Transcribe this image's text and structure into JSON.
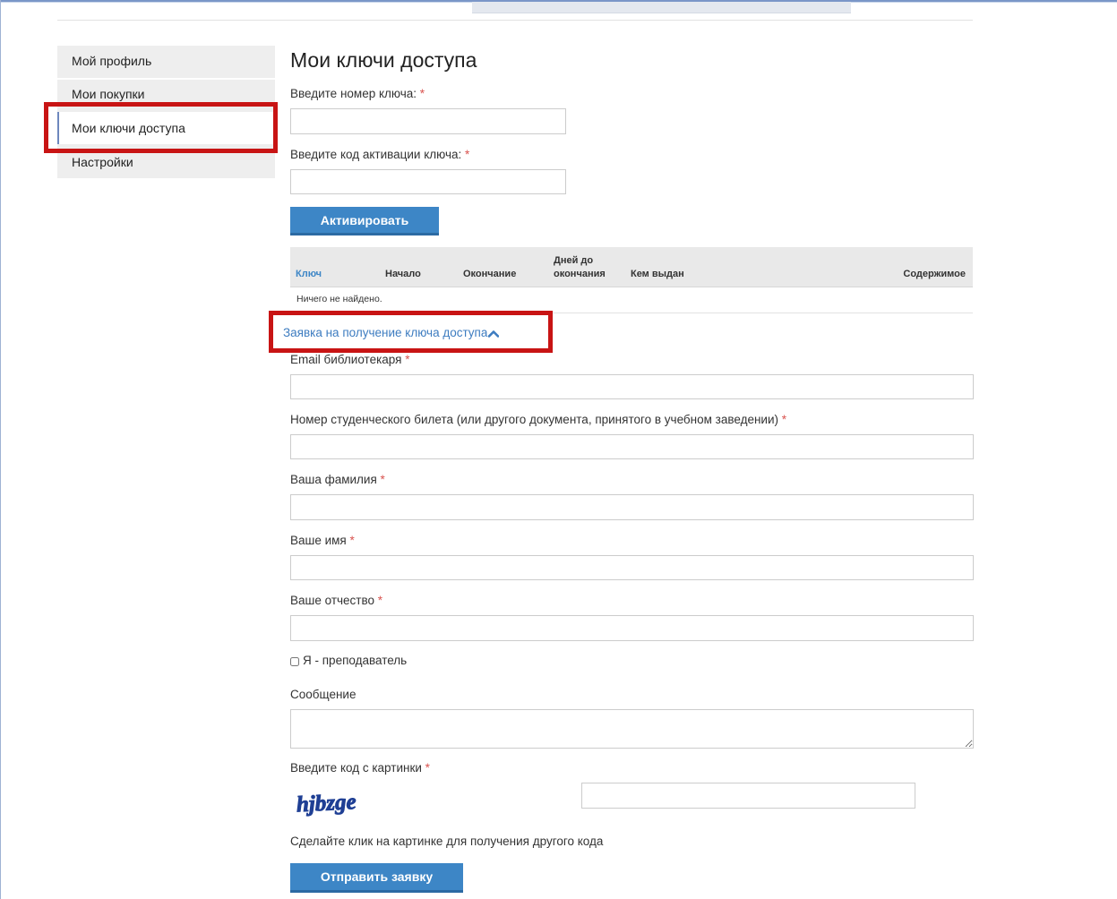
{
  "sidebar": {
    "items": [
      {
        "label": "Мой профиль"
      },
      {
        "label": "Мои покупки"
      },
      {
        "label": "Мои ключи доступа"
      },
      {
        "label": "Настройки"
      }
    ]
  },
  "main": {
    "title": "Мои ключи доступа",
    "key_number_label": "Введите номер ключа: ",
    "key_number_value": "",
    "activation_code_label": "Введите код активации ключа: ",
    "activation_code_value": "",
    "activate_button": "Активировать",
    "required_mark": "*"
  },
  "table": {
    "columns": [
      "Ключ",
      "Начало",
      "Окончание",
      "Дней до",
      "окончания",
      "Кем выдан",
      "Содержимое"
    ],
    "empty_text": "Ничего не найдено."
  },
  "request_form": {
    "toggle_label": "Заявка на получение ключа доступа",
    "fields": {
      "email_label": "Email библиотекаря ",
      "student_id_label": "Номер студенческого билета (или другого документа, принятого в учебном заведении) ",
      "last_name_label": "Ваша фамилия ",
      "first_name_label": "Ваше имя ",
      "middle_name_label": "Ваше отчество ",
      "teacher_checkbox_label": "Я - преподаватель",
      "message_label": "Сообщение",
      "captcha_label": "Введите код с картинки ",
      "captcha_image_text": "hjbzge",
      "captcha_hint": "Сделайте клик на картинке для получения другого кода"
    },
    "teacher_checked": false,
    "submit_button": "Отправить заявку"
  },
  "colors": {
    "accent": "#3d86c6",
    "link": "#3d7cc0",
    "required": "#d9534f",
    "highlight": "#c81414",
    "sidebar_bg": "#eeeeee"
  }
}
